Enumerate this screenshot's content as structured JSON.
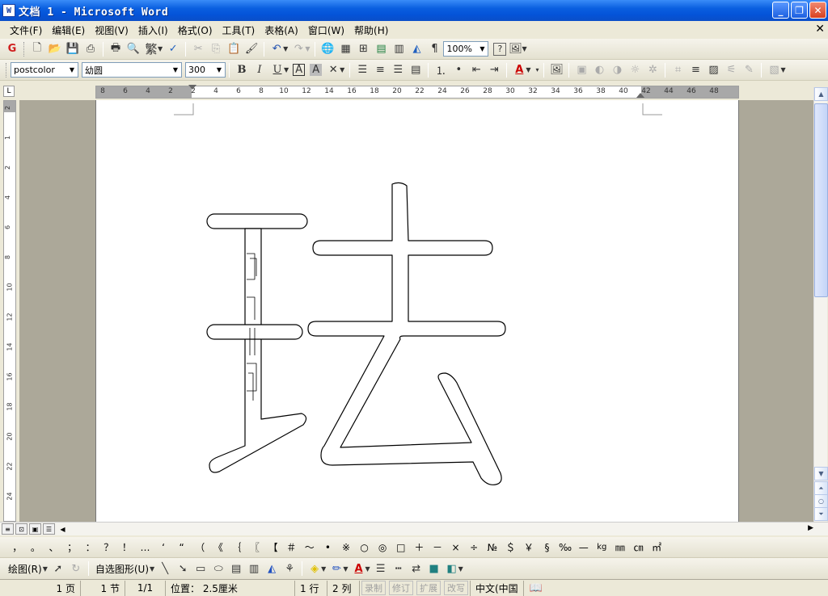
{
  "window": {
    "title": "文档 1 - Microsoft Word",
    "app_icon": "W"
  },
  "menu": [
    "文件(F)",
    "编辑(E)",
    "视图(V)",
    "插入(I)",
    "格式(O)",
    "工具(T)",
    "表格(A)",
    "窗口(W)",
    "帮助(H)"
  ],
  "toolbar": {
    "zoom": "100%",
    "traditional_label": "繁"
  },
  "format": {
    "style": "postcolor",
    "font": "幼圆",
    "size": "300",
    "bold": "B",
    "italic": "I",
    "underline": "U",
    "char_border": "A",
    "char_shading": "A",
    "font_color": "A"
  },
  "ruler": {
    "h_ticks": [
      "8",
      "6",
      "4",
      "2",
      "2",
      "4",
      "6",
      "8",
      "10",
      "12",
      "14",
      "16",
      "18",
      "20",
      "22",
      "24",
      "26",
      "28",
      "30",
      "32",
      "34",
      "36",
      "38",
      "40",
      "42",
      "44",
      "46",
      "48"
    ],
    "v_ticks": [
      "2",
      "1",
      "2",
      "4",
      "6",
      "8",
      "10",
      "12",
      "14",
      "16",
      "18",
      "20",
      "22",
      "24"
    ]
  },
  "document": {
    "glyph": "珐"
  },
  "symbols": [
    "，",
    "。",
    "、",
    "；",
    "：",
    "？",
    "！",
    "…",
    "‘",
    "“",
    "（",
    "《",
    "｛",
    "〖",
    "【",
    "＃",
    "～",
    "•",
    "※",
    "○",
    "◎",
    "□",
    "＋",
    "－",
    "×",
    "÷",
    "№",
    "＄",
    "￥",
    "§",
    "‰",
    "—",
    "kg",
    "㎜",
    "㎝",
    "㎡"
  ],
  "drawing": {
    "draw_label": "绘图(R)",
    "autoshape_label": "自选图形(U)"
  },
  "status": {
    "page": "1 页",
    "section": "1 节",
    "page_of": "1/1",
    "position": "位置： 2.5厘米",
    "line": "1 行",
    "col": "2 列",
    "rec": "录制",
    "trk": "修订",
    "ext": "扩展",
    "ovr": "改写",
    "language": "中文(中国"
  }
}
